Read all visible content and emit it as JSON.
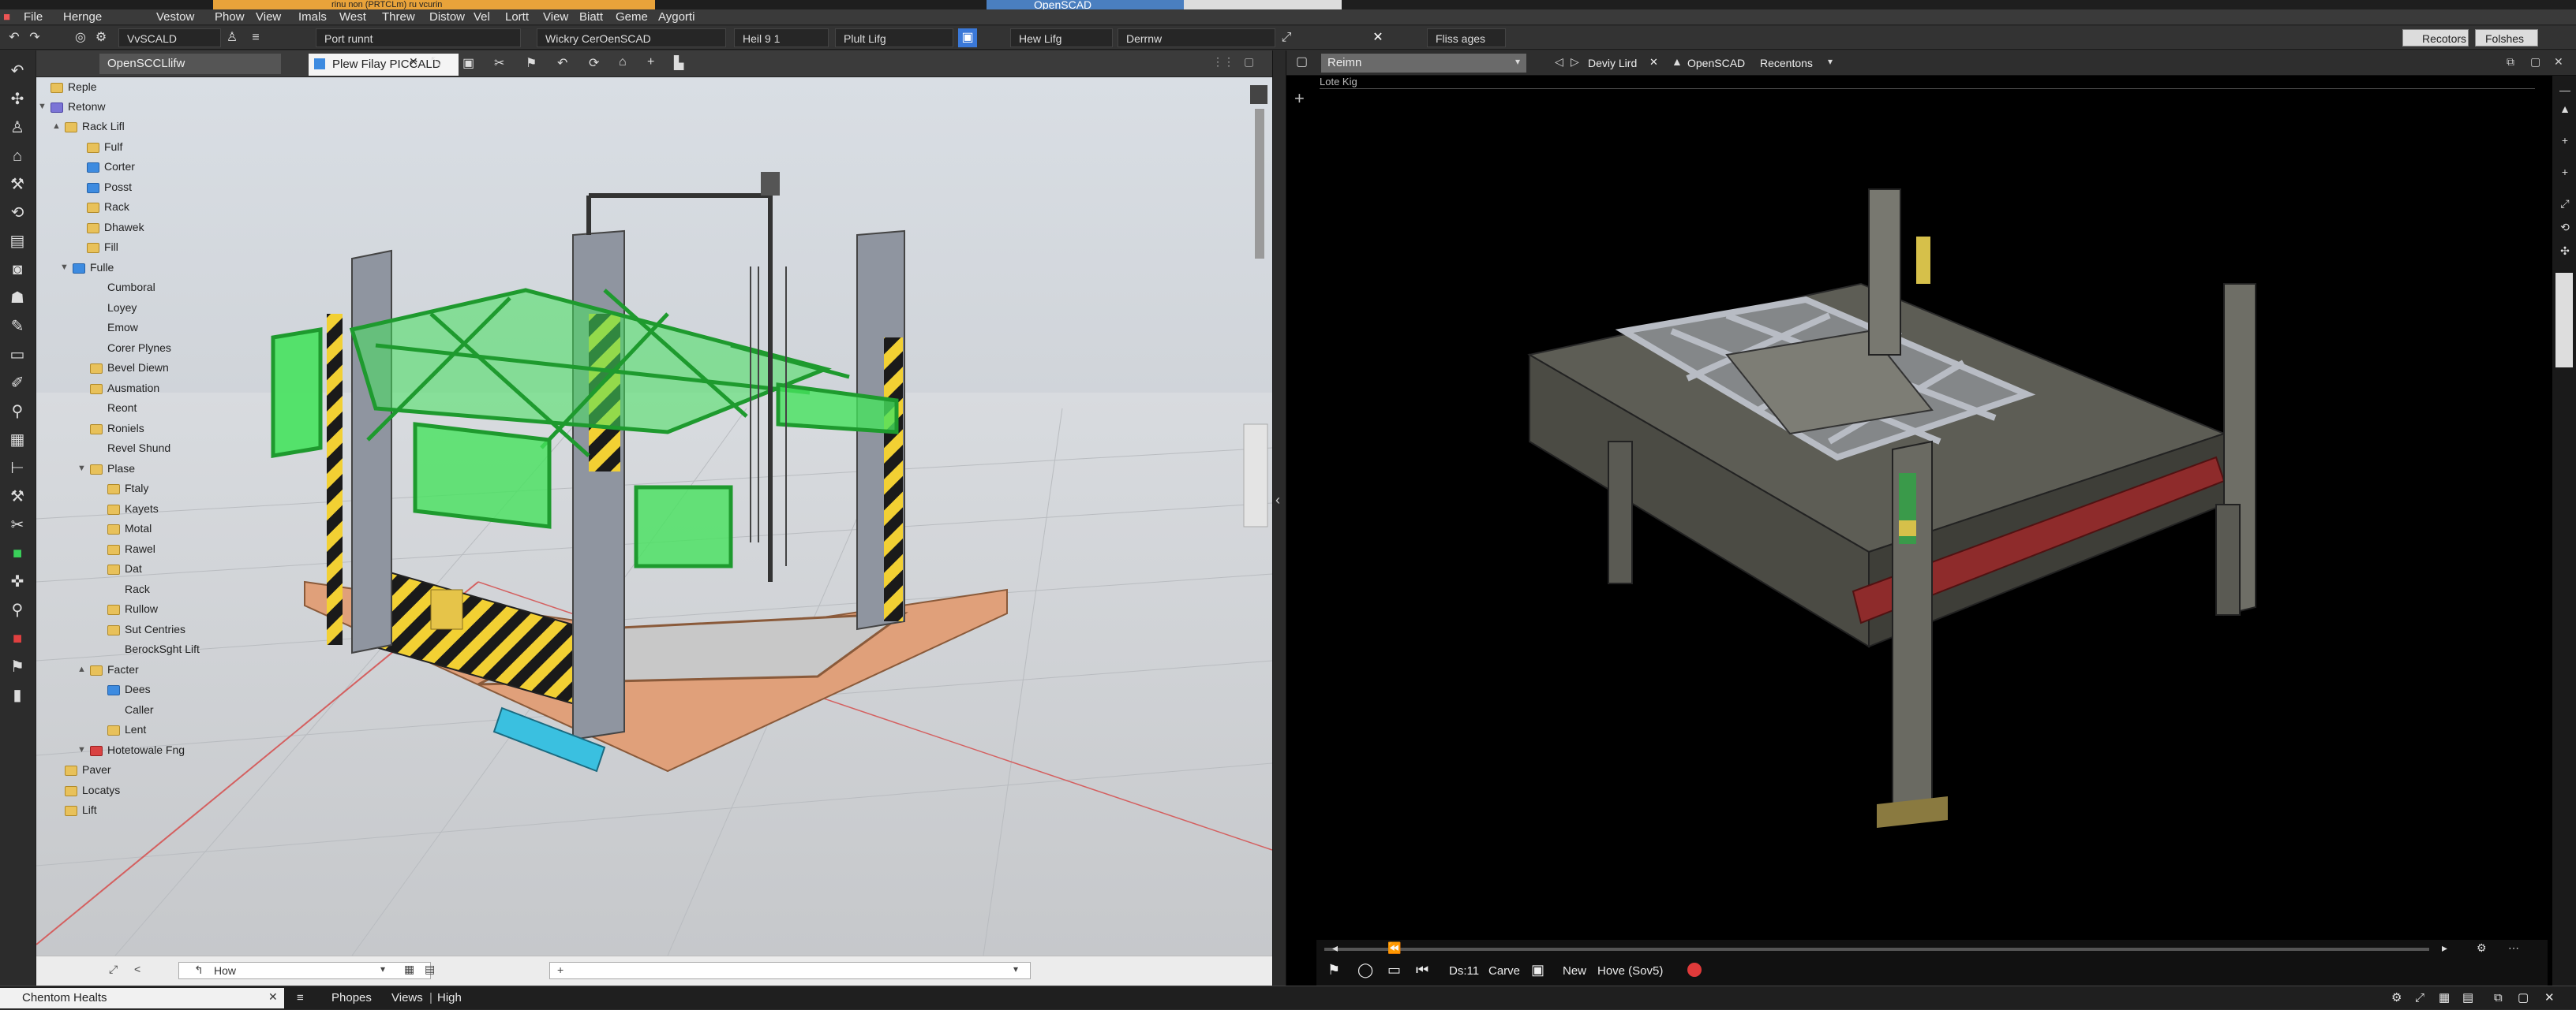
{
  "titlebar": {
    "tab_a": "rinu non (PRTCLm) ru vcurin",
    "tab_b": "OpenSCAD"
  },
  "menubar": {
    "items": [
      "File",
      "Hernge",
      "Vestow",
      "Phow",
      "View",
      "Imals",
      "West",
      "Threw",
      "Distow",
      "Vel",
      "Lortt",
      "View",
      "Biatt",
      "Geme",
      "Aygorti"
    ]
  },
  "toolbar": {
    "box1": "VvSCALD",
    "box2": "Port runnt",
    "box3": "Wickry CerOenSCAD",
    "box4": "Heil 9 1",
    "box5": "Plult Lifg",
    "box6": "Hew Lifg",
    "box7": "Derrnw",
    "box8": "Fliss ages",
    "btn_right1": "Recotors",
    "btn_right2": "Folshes"
  },
  "left_panel": {
    "selector": "OpenSCCLlifw",
    "tab": "Plew Filay PICCALD",
    "tree": [
      {
        "label": "Reple",
        "icon": "yellow"
      },
      {
        "label": "Retonw",
        "icon": "purple"
      },
      {
        "label": "Rack Lifl",
        "icon": "yellow"
      },
      {
        "label": "Fulf",
        "icon": "yellow"
      },
      {
        "label": "Corter",
        "icon": "blue"
      },
      {
        "label": "Posst",
        "icon": "blue"
      },
      {
        "label": "Rack",
        "icon": "yellow"
      },
      {
        "label": "Dhawek",
        "icon": "yellow"
      },
      {
        "label": "Fill",
        "icon": "yellow"
      },
      {
        "label": "Fulle",
        "icon": "blue"
      },
      {
        "label": "Cumboral",
        "icon": "none"
      },
      {
        "label": "Loyey",
        "icon": "none"
      },
      {
        "label": "Emow",
        "icon": "none"
      },
      {
        "label": "Corer Plynes",
        "icon": "none"
      },
      {
        "label": "Bevel Diewn",
        "icon": "yellow"
      },
      {
        "label": "Ausmation",
        "icon": "yellow"
      },
      {
        "label": "Reont",
        "icon": "none"
      },
      {
        "label": "Roniels",
        "icon": "yellow"
      },
      {
        "label": "Revel Shund",
        "icon": "none"
      },
      {
        "label": "Plase",
        "icon": "yellow"
      },
      {
        "label": "Ftaly",
        "icon": "yellow"
      },
      {
        "label": "Kayets",
        "icon": "yellow"
      },
      {
        "label": "Motal",
        "icon": "yellow"
      },
      {
        "label": "Rawel",
        "icon": "yellow"
      },
      {
        "label": "Dat",
        "icon": "yellow"
      },
      {
        "label": "Rack",
        "icon": "none"
      },
      {
        "label": "Rullow",
        "icon": "yellow"
      },
      {
        "label": "Sut Centries",
        "icon": "yellow"
      },
      {
        "label": "BerockSght Lift",
        "icon": "none"
      },
      {
        "label": "Facter",
        "icon": "yellow"
      },
      {
        "label": "Dees",
        "icon": "blue"
      },
      {
        "label": "Caller",
        "icon": "none"
      },
      {
        "label": "Lent",
        "icon": "yellow"
      },
      {
        "label": "Hotetowale Fng",
        "icon": "red"
      },
      {
        "label": "Paver",
        "icon": "yellow"
      },
      {
        "label": "Locatys",
        "icon": "yellow"
      },
      {
        "label": "Lift",
        "icon": "yellow"
      }
    ],
    "footer_input": "How"
  },
  "right_panel": {
    "selector": "Reimn",
    "breadcrumb": "Deviy Lird",
    "app_label": "OpenSCAD",
    "recent": "Recentons",
    "viewport_label": "Lote Kig",
    "footer": {
      "item1": "Ds:11",
      "item2": "Carve",
      "item3": "New",
      "item4": "Hove (Sov5)"
    }
  },
  "statusbar": {
    "tab": "Chentom Healts",
    "item1": "Phopes",
    "item2": "Views",
    "item3": "High"
  },
  "colors": {
    "accent_green": "#3aff4e",
    "steel": "#8a9099",
    "wood": "#e0a07a",
    "warning_yellow": "#f2d033",
    "red_beam": "#8e2b2b"
  }
}
